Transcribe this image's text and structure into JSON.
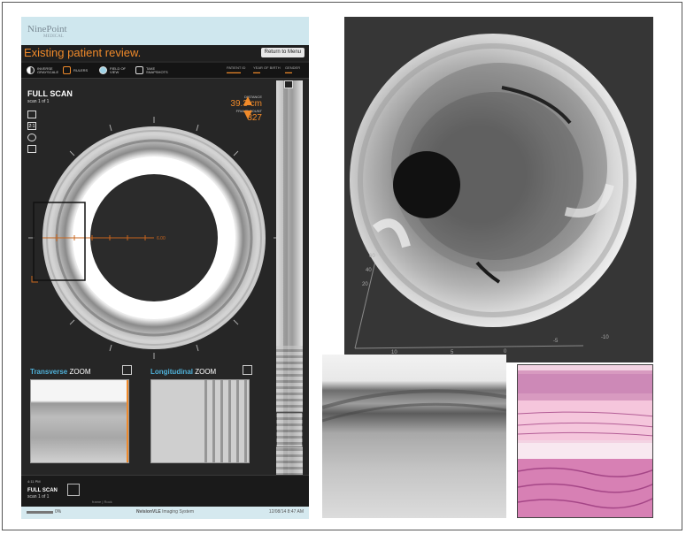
{
  "app": {
    "logo": "NinePoint",
    "logo_sub": "MEDICAL",
    "title": "Existing patient review.",
    "return_label": "Return to Menu",
    "toolbar": {
      "items": [
        {
          "label": "INVERSE GRAYSCALE",
          "icon": "contrast-icon"
        },
        {
          "label": "RULERS",
          "icon": "ruler-icon"
        },
        {
          "label": "FIELD OF VIEW",
          "icon": "eye-icon"
        },
        {
          "label": "TAKE SNAPSHOTS",
          "icon": "camera-icon"
        }
      ],
      "patient_id_label": "PATIENT ID",
      "birth_year_label": "YEAR OF BIRTH",
      "gender_label": "GENDER"
    },
    "scan_title": "FULL SCAN",
    "scan_subtitle": "scan 1 of 1",
    "side_icons": [
      {
        "name": "frame-icon",
        "text": ""
      },
      {
        "name": "zoom-ratio-icon",
        "text": "2:1"
      },
      {
        "name": "rotate-icon",
        "text": ""
      },
      {
        "name": "monitor-icon",
        "text": ""
      }
    ],
    "distance_label": "DISTANCE",
    "distance_value": "39.3 cm",
    "frame_count_label": "FRAME COUNT",
    "frame_count_value": "327",
    "ruler_value": "6.00",
    "transverse_zoom": {
      "strong": "Transverse",
      "rest": " ZOOM"
    },
    "longitudinal_zoom": {
      "strong": "Longitudinal",
      "rest": " ZOOM"
    },
    "bottom": {
      "small_label": "4:11 PM",
      "title": "FULL SCAN",
      "subtitle": "scan 1 of 1",
      "frame_text": "frame | Rock"
    },
    "status": {
      "zoom_value": "0%",
      "brand_strong": "NvisionVLE",
      "brand_rest": " Imaging System",
      "time": "12/08/14 8:47 AM"
    }
  },
  "volume_axis": {
    "x_ticks": [
      "10",
      "5",
      "0",
      "-5",
      "-10"
    ],
    "z_ticks": [
      "20",
      "40",
      "60"
    ]
  },
  "colors": {
    "accent_orange": "#f08a2a",
    "header_blue": "#cfe7ee",
    "zoom_blue": "#4fb0d8",
    "panel_dark": "#262626",
    "volume_bg": "#363636"
  }
}
